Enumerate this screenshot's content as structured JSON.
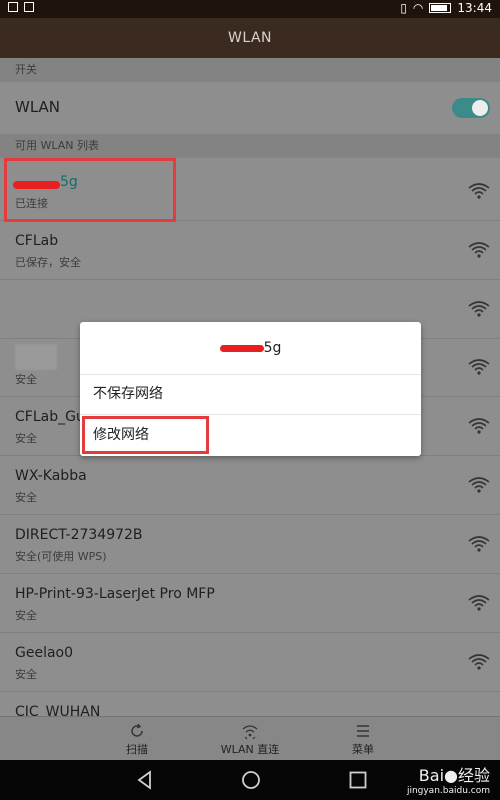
{
  "status_bar": {
    "time": "13:44"
  },
  "title": "WLAN",
  "sections": {
    "switch_header": "开关",
    "list_header": "可用 WLAN 列表"
  },
  "wlan_toggle": {
    "label": "WLAN",
    "on": true
  },
  "networks": [
    {
      "name": "5g",
      "status": "已连接"
    },
    {
      "name": "CFLab",
      "status": "已保存，安全"
    },
    {
      "name": "",
      "status": ""
    },
    {
      "name": "",
      "status": "安全"
    },
    {
      "name": "CFLab_Gue",
      "status": "安全"
    },
    {
      "name": "WX-Kabba",
      "status": "安全"
    },
    {
      "name": "DIRECT-2734972B",
      "status": "安全(可使用 WPS)"
    },
    {
      "name": "HP-Print-93-LaserJet Pro MFP",
      "status": "安全"
    },
    {
      "name": "Geelao0",
      "status": "安全"
    },
    {
      "name": "CIC_WUHAN",
      "status": ""
    }
  ],
  "dialog": {
    "title": "5g",
    "items": [
      "不保存网络",
      "修改网络"
    ]
  },
  "bottom_bar": {
    "scan": "扫描",
    "direct": "WLAN 直连",
    "menu": "菜单"
  },
  "watermark": {
    "brand": "Bai",
    "brand2": "经验",
    "url": "jingyan.baidu.com"
  },
  "colors": {
    "accent": "#3b8c89",
    "highlight": "#e33c3c"
  }
}
